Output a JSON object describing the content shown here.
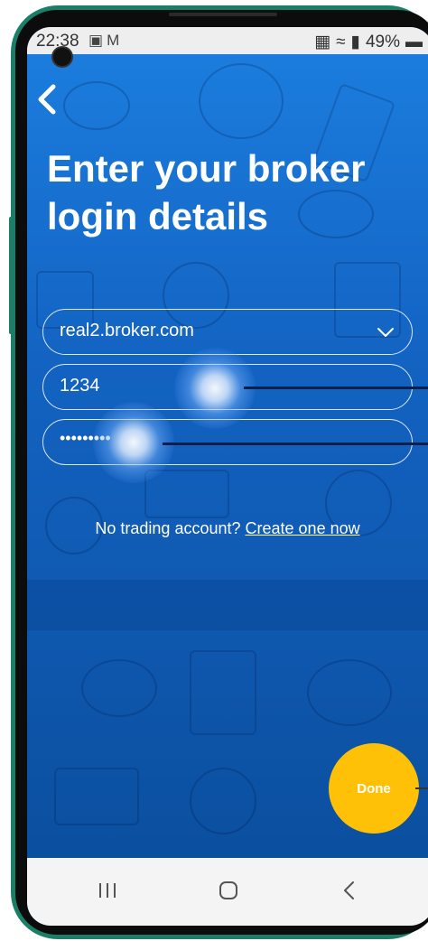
{
  "status_bar": {
    "time": "22:38",
    "battery": "49%"
  },
  "icons": {
    "back": "chevron-left-icon",
    "dropdown": "chevron-down-icon",
    "gallery": "image-icon",
    "gmail": "gmail-icon",
    "nfc": "nfc-icon",
    "wifi": "wifi-icon",
    "signal": "signal-icon",
    "battery": "battery-icon",
    "recents": "recents-icon",
    "home": "home-icon",
    "nav_back": "nav-back-icon"
  },
  "title": {
    "line1": "Enter your broker",
    "line2": "login details"
  },
  "form": {
    "server": "real2.broker.com",
    "login": "1234",
    "password": "•••••••••"
  },
  "signup": {
    "prompt": "No trading account?",
    "link": "Create one now"
  },
  "done_label": "Done",
  "colors": {
    "accent": "#ffc107",
    "background_top": "#1c7fe0",
    "background_bottom": "#0b4f9f",
    "phone_frame": "#1b7f67"
  }
}
